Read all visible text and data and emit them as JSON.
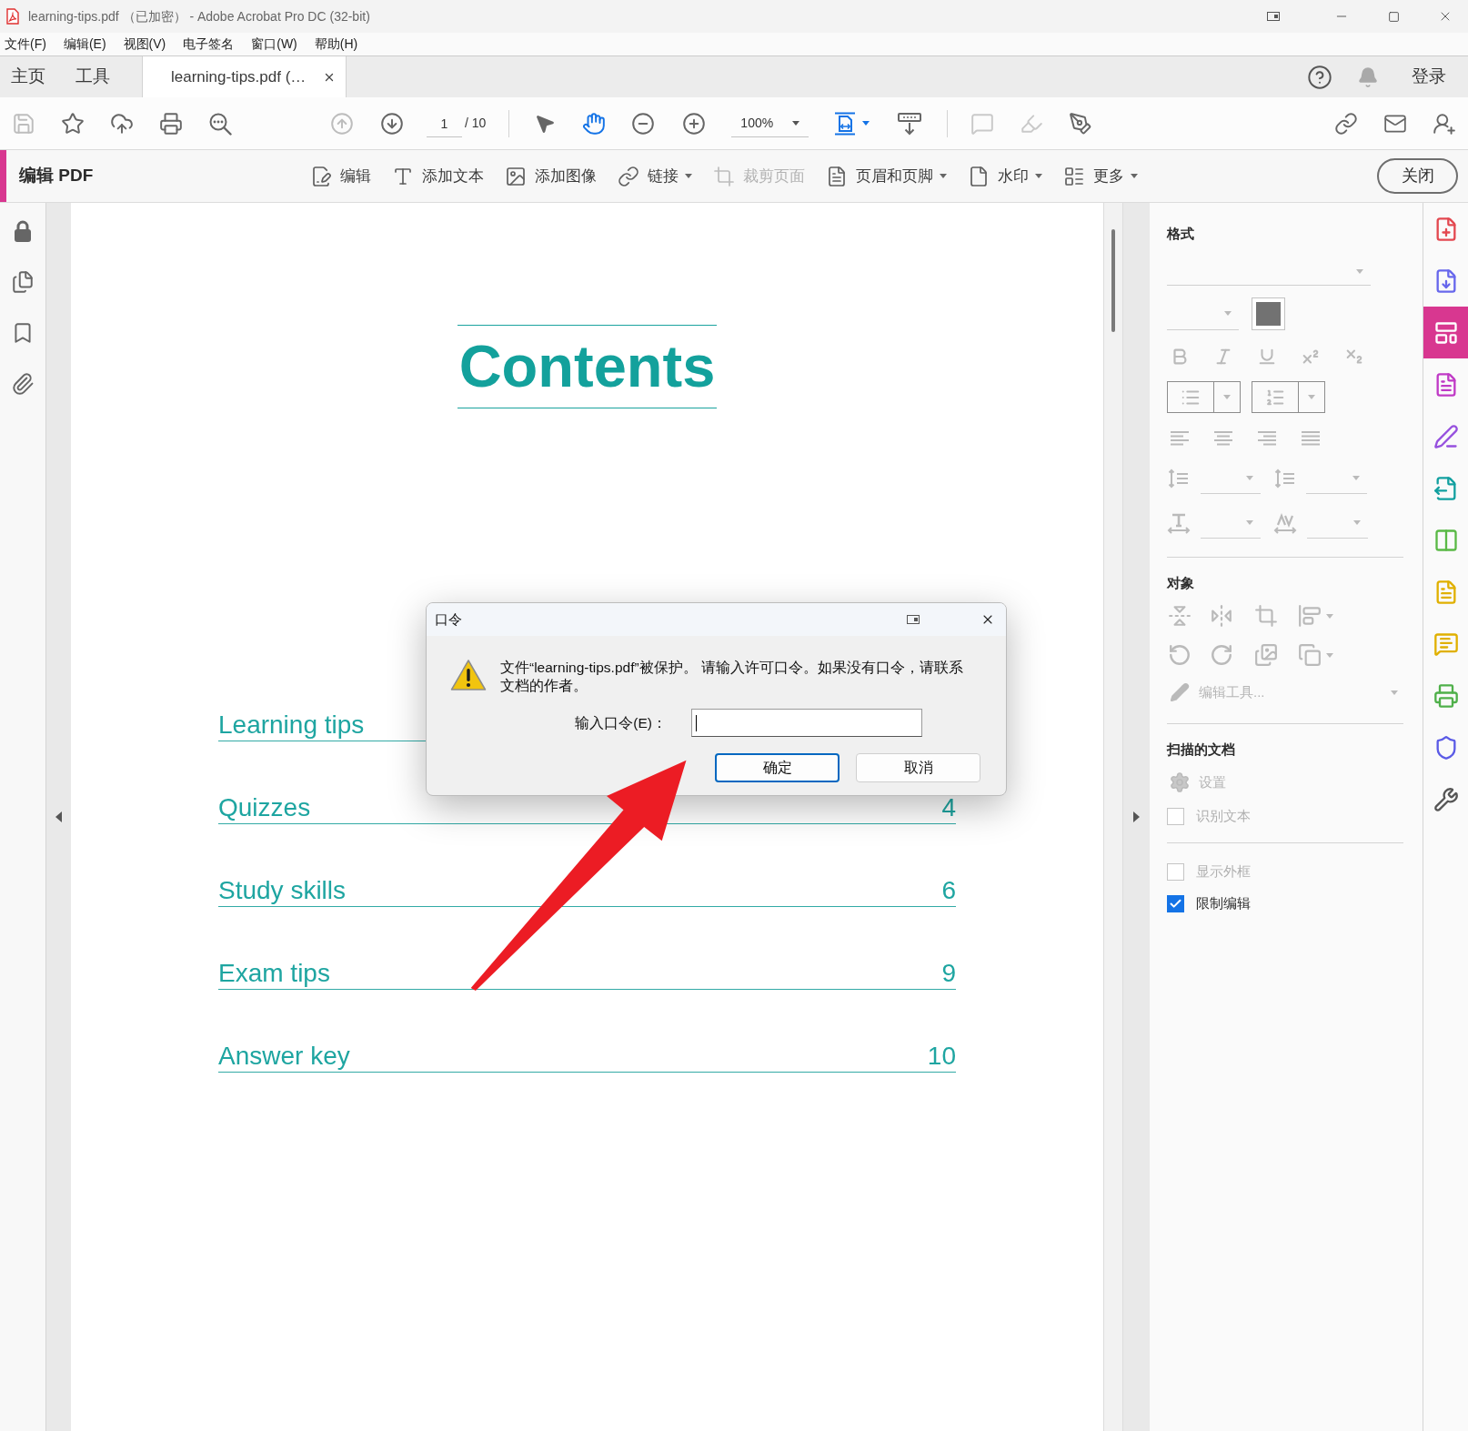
{
  "window": {
    "title": "learning-tips.pdf （已加密） - Adobe Acrobat Pro DC (32-bit)"
  },
  "menu": [
    "文件(F)",
    "编辑(E)",
    "视图(V)",
    "电子签名",
    "窗口(W)",
    "帮助(H)"
  ],
  "tabs": [
    {
      "label": "主页",
      "kind": "nav",
      "selected": false
    },
    {
      "label": "工具",
      "kind": "nav",
      "selected": false
    },
    {
      "label": "learning-tips.pdf (…",
      "kind": "document",
      "selected": true
    }
  ],
  "header_right": {
    "sign_in": "登录"
  },
  "toolbar": {
    "file_buttons": [
      {
        "kind": "save",
        "disabled": true
      },
      {
        "kind": "star",
        "disabled": false
      },
      {
        "kind": "upload",
        "disabled": false
      },
      {
        "kind": "print",
        "disabled": false
      },
      {
        "kind": "find",
        "disabled": false
      }
    ],
    "page_buttons": [
      {
        "kind": "previous",
        "disabled": true
      },
      {
        "kind": "next",
        "disabled": false
      }
    ],
    "page_number": "1",
    "page_count": "/ 10",
    "mode_buttons": [
      {
        "kind": "select",
        "selected": false
      },
      {
        "kind": "pan",
        "selected": true
      }
    ],
    "zoom": "100%",
    "view_buttons": [
      {
        "kind": "fit",
        "selected": true
      },
      {
        "kind": "scroll",
        "selected": false
      }
    ],
    "markup_buttons": [
      {
        "kind": "comment",
        "disabled": true
      },
      {
        "kind": "highlight",
        "disabled": true
      },
      {
        "kind": "sign",
        "disabled": false
      }
    ]
  },
  "edit_bar": {
    "title": "编辑 PDF",
    "tools": [
      {
        "label": "编辑",
        "kind": "edit",
        "dropdown": false,
        "disabled": false
      },
      {
        "label": "添加文本",
        "kind": "text",
        "dropdown": false,
        "disabled": false
      },
      {
        "label": "添加图像",
        "kind": "image",
        "dropdown": false,
        "disabled": false
      },
      {
        "label": "链接",
        "kind": "link",
        "dropdown": true,
        "disabled": false
      },
      {
        "label": "裁剪页面",
        "kind": "crop",
        "dropdown": false,
        "disabled": true
      },
      {
        "label": "页眉和页脚",
        "kind": "header",
        "dropdown": true,
        "disabled": false
      },
      {
        "label": "水印",
        "kind": "watermark",
        "dropdown": true,
        "disabled": false
      },
      {
        "label": "更多",
        "kind": "more",
        "dropdown": true,
        "disabled": false
      }
    ],
    "close": "关闭"
  },
  "page": {
    "heading": "Contents",
    "toc": [
      {
        "title": "Learning tips"
      },
      {
        "title": "Quizzes",
        "page": "4"
      },
      {
        "title": "Study skills",
        "page": "6"
      },
      {
        "title": "Exam tips",
        "page": "9"
      },
      {
        "title": "Answer key",
        "page": "10"
      }
    ]
  },
  "properties_panel": {
    "format": {
      "heading": "格式",
      "disabled": true
    },
    "object": {
      "heading": "对象",
      "disabled": true,
      "edit_tools": "编辑工具..."
    },
    "scanned": {
      "heading": "扫描的文档",
      "settings": {
        "label": "设置",
        "disabled": true
      },
      "options": [
        {
          "label": "识别文本",
          "checked": false,
          "disabled": true
        }
      ]
    },
    "options": [
      {
        "label": "显示外框",
        "checked": false,
        "disabled": true
      },
      {
        "label": "限制编辑",
        "checked": true,
        "disabled": false
      }
    ]
  },
  "tool_rail": [
    {
      "kind": "create",
      "selected": false
    },
    {
      "kind": "export",
      "selected": false
    },
    {
      "kind": "edit",
      "selected": true
    },
    {
      "kind": "form",
      "selected": false
    },
    {
      "kind": "sign",
      "selected": false
    },
    {
      "kind": "send",
      "selected": false
    },
    {
      "kind": "organize",
      "selected": false
    },
    {
      "kind": "share",
      "selected": false
    },
    {
      "kind": "comment",
      "selected": false
    },
    {
      "kind": "scan",
      "selected": false
    },
    {
      "kind": "protect",
      "selected": false
    },
    {
      "kind": "more",
      "selected": false
    }
  ],
  "dialog": {
    "title": "口令",
    "message": "文件“learning-tips.pdf”被保护。 请输入许可口令。如果没有口令，请联系文档的作者。",
    "password": {
      "label": "输入口令(E)：",
      "focused": true
    },
    "buttons": [
      {
        "label": "确定",
        "default": true
      },
      {
        "label": "取消",
        "default": false
      }
    ]
  }
}
